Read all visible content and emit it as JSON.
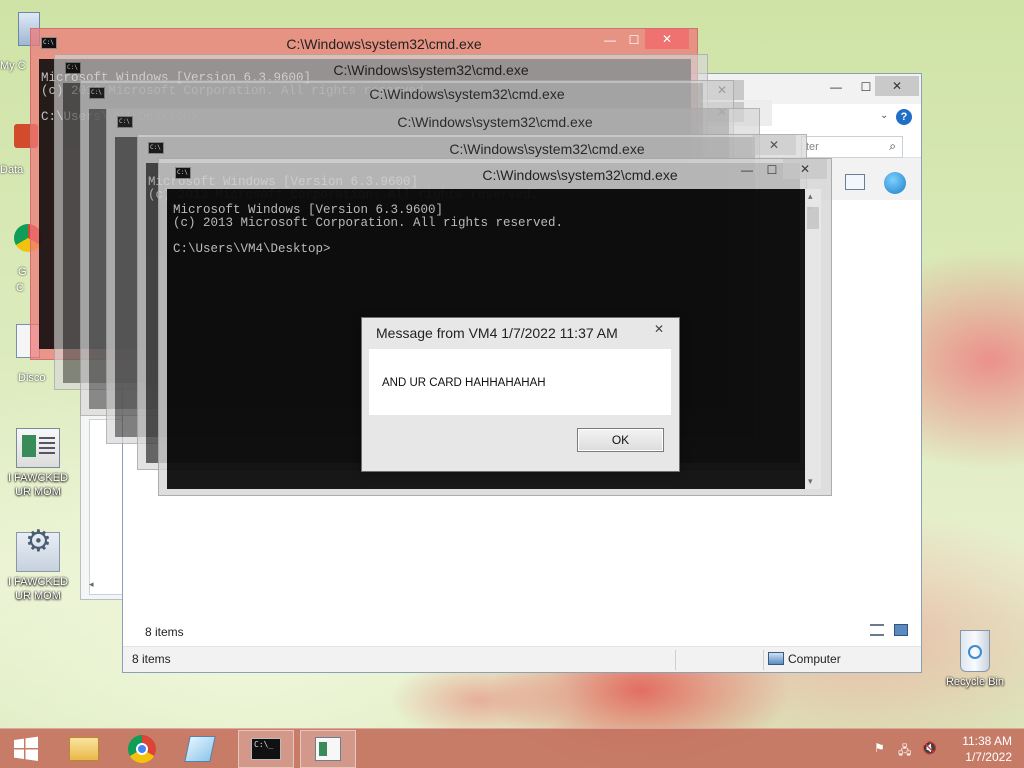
{
  "desktop": {
    "partial_icons": [
      {
        "label": "My C"
      },
      {
        "label": "Data"
      },
      {
        "label": "G"
      },
      {
        "label": "C"
      },
      {
        "label": "Disco"
      }
    ],
    "icons": [
      {
        "label": "I FAWCKED UR MOM"
      },
      {
        "label": "I FAWCKED UR MOM"
      }
    ],
    "recycle_bin": {
      "label": "Recycle Bin"
    }
  },
  "cmd_windows": [
    {
      "title": "C:\\Windows\\system32\\cmd.exe"
    },
    {
      "title": "C:\\Windows\\system32\\cmd.exe"
    },
    {
      "title": "C:\\Windows\\system32\\cmd.exe"
    },
    {
      "title": "C:\\Windows\\system32\\cmd.exe"
    },
    {
      "title": "C:\\Windows\\system32\\cmd.exe"
    },
    {
      "title": "C:\\Windows\\system32\\cmd.exe"
    }
  ],
  "console": {
    "line1": "Microsoft Windows [Version 6.3.9600]",
    "line2": "(c) 2013 Microsoft Corporation. All rights reserved.",
    "prompt": "C:\\Users\\VM4\\Desktop>"
  },
  "explorer": {
    "search_placeholder": "ter",
    "status_items": "8 items",
    "status_items_back": "8 items",
    "status_location": "Computer"
  },
  "message_box": {
    "title": "Message from VM4 1/7/2022 11:37 AM",
    "text": "AND UR CARD HAHHAHAHAH",
    "ok_label": "OK"
  },
  "taskbar": {
    "items": [
      {
        "name": "file-explorer"
      },
      {
        "name": "chrome"
      },
      {
        "name": "notepad"
      },
      {
        "name": "cmd"
      },
      {
        "name": "document"
      }
    ],
    "time": "11:38 AM",
    "date": "1/7/2022"
  },
  "colors": {
    "taskbar": "#c47260",
    "active_cmd_titlebar": "#ee7878",
    "console_bg": "#0b0b0b",
    "console_text": "#c0c0c0"
  }
}
